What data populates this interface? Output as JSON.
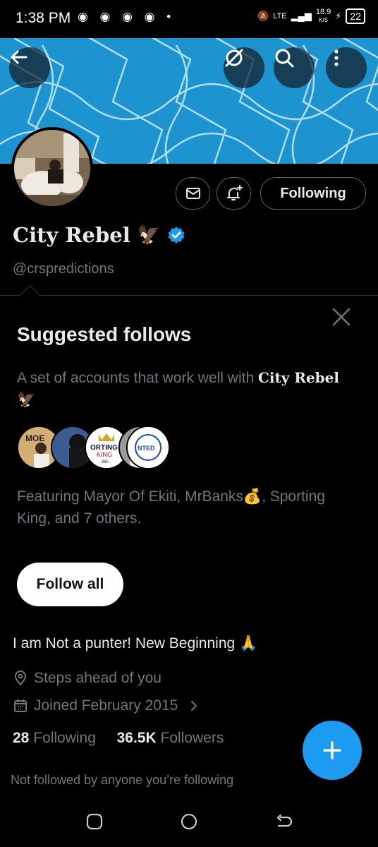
{
  "status_bar": {
    "time": "1:38 PM",
    "network": "LTE",
    "speed": "18.9",
    "speed_unit": "K/S",
    "battery": "22"
  },
  "profile": {
    "name": "City Rebel",
    "name_emoji": "🦅",
    "verified": true,
    "handle": "@crspredictions",
    "following_label": "Following",
    "bio": "I am Not a punter! New Beginning 🙏",
    "location": "Steps ahead of you",
    "joined": "Joined February 2015",
    "following_count": "28",
    "following_word": "Following",
    "followers_count": "36.5K",
    "followers_word": "Followers",
    "not_followed_note": "Not followed by anyone you’re following"
  },
  "suggested": {
    "title": "Suggested follows",
    "desc_prefix": "A set of accounts that work well with",
    "desc_name": "City Rebel",
    "desc_emoji": "🦅",
    "avatar_1_text": "MOE",
    "avatar_3_text": "ORTING",
    "avatar_3_text2": "KING",
    "avatar_3_text3": "· 365 ·",
    "avatar_5_text": "NTED",
    "featuring": "Featuring Mayor Of Ekiti, MrBanks💰, Sporting King, and 7 others.",
    "follow_all_label": "Follow all"
  },
  "colors": {
    "accent": "#1d9bf0",
    "banner": "#1d93d0",
    "muted_text": "#71767b"
  },
  "icons": [
    "back-arrow-icon",
    "grok-icon",
    "search-icon",
    "more-icon",
    "mail-icon",
    "bell-plus-icon",
    "verified-badge-icon",
    "close-icon",
    "location-icon",
    "calendar-icon",
    "chevron-right-icon",
    "plus-icon",
    "recents-icon",
    "home-icon",
    "back-icon"
  ]
}
